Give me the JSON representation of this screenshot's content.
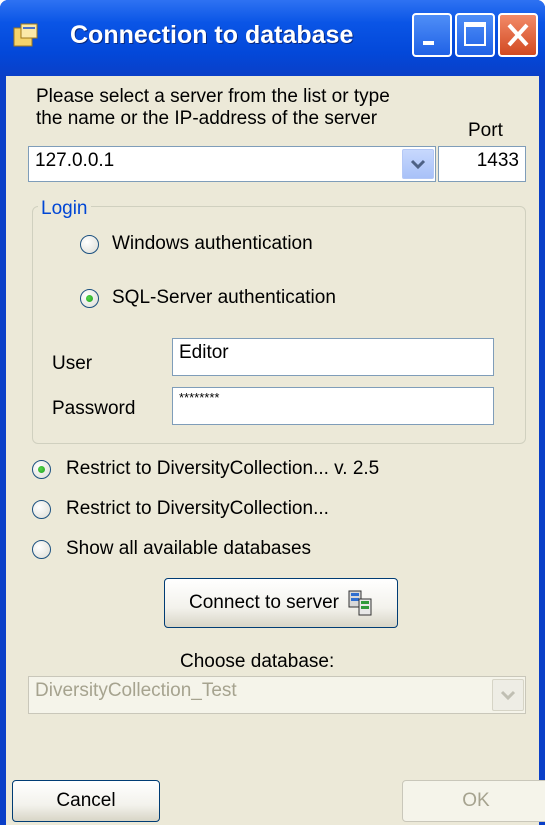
{
  "window": {
    "title": "Connection to database",
    "icons": [
      "app-icon",
      "minimize-icon",
      "maximize-icon",
      "close-icon"
    ]
  },
  "server": {
    "instruction": "Please select a server from the list or type the name or the IP-address of the server",
    "instruction_line1": "Please select a server from the list or type",
    "instruction_line2": "the name or the IP-address of the server",
    "value": "127.0.0.1",
    "port_label": "Port",
    "port_value": "1433"
  },
  "login": {
    "legend": "Login",
    "windows_auth": "Windows authentication",
    "sql_auth": "SQL-Server authentication",
    "selected": "sql",
    "user_label": "User",
    "user_value": "Editor",
    "password_label": "Password",
    "password_value": "********"
  },
  "restrict": {
    "option1": "Restrict to DiversityCollection... v. 2.5",
    "option2": "Restrict to DiversityCollection...",
    "option3": "Show all available databases",
    "selected": "option1"
  },
  "connect_button": "Connect to server",
  "database": {
    "label": "Choose database:",
    "value": "DiversityCollection_Test"
  },
  "buttons": {
    "cancel": "Cancel",
    "ok": "OK"
  },
  "colors": {
    "titlebar": "#0a55e6",
    "client": "#ece9d8",
    "legend": "#0046d5",
    "close": "#d24a22"
  }
}
